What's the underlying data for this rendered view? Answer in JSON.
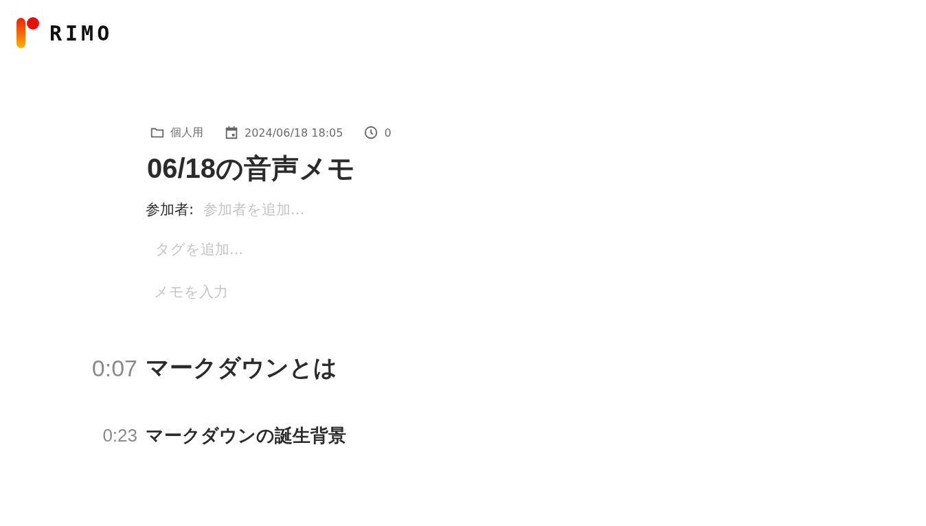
{
  "logo": {
    "text": "RIMO"
  },
  "meta": {
    "folder": "個人用",
    "date": "2024/06/18 18:05",
    "duration": "0"
  },
  "title": "06/18の音声メモ",
  "participants": {
    "label": "参加者:",
    "placeholder": "参加者を追加..."
  },
  "tags": {
    "placeholder": "タグを追加..."
  },
  "memo": {
    "placeholder": "メモを入力"
  },
  "sections": [
    {
      "time": "0:07",
      "heading": "マークダウンとは",
      "kind": "h2"
    },
    {
      "time": "0:23",
      "heading": "マークダウンの誕生背景",
      "kind": "h3"
    }
  ]
}
